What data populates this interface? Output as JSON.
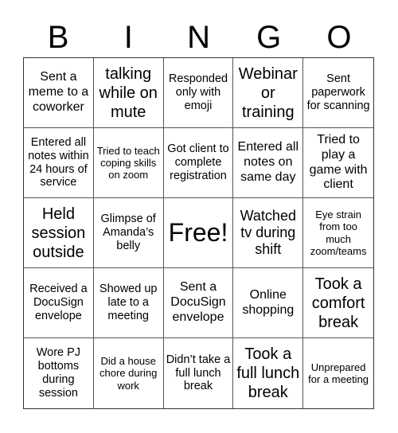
{
  "header": {
    "letters": [
      "B",
      "I",
      "N",
      "G",
      "O"
    ]
  },
  "cells": [
    {
      "text": "Sent a meme to a coworker"
    },
    {
      "text": "talking while on mute"
    },
    {
      "text": "Responded only with emoji"
    },
    {
      "text": "Webinar or training"
    },
    {
      "text": "Sent paperwork for scanning"
    },
    {
      "text": "Entered all notes within 24 hours of service"
    },
    {
      "text": "Tried to teach coping skills on zoom"
    },
    {
      "text": "Got client to complete registration"
    },
    {
      "text": "Entered all notes on same day"
    },
    {
      "text": "Tried to play a game with client"
    },
    {
      "text": "Held session outside"
    },
    {
      "text": "Glimpse of Amanda’s belly"
    },
    {
      "text": "Free!"
    },
    {
      "text": "Watched tv during shift"
    },
    {
      "text": "Eye strain from too much zoom/teams"
    },
    {
      "text": "Received a DocuSign envelope"
    },
    {
      "text": "Showed up late to a meeting"
    },
    {
      "text": "Sent a DocuSign envelope"
    },
    {
      "text": "Online shopping"
    },
    {
      "text": "Took a comfort break"
    },
    {
      "text": "Wore PJ bottoms during session"
    },
    {
      "text": "Did a house chore during work"
    },
    {
      "text": "Didn’t take a full lunch break"
    },
    {
      "text": "Took a full lunch break"
    },
    {
      "text": "Unprepared for a meeting"
    }
  ]
}
